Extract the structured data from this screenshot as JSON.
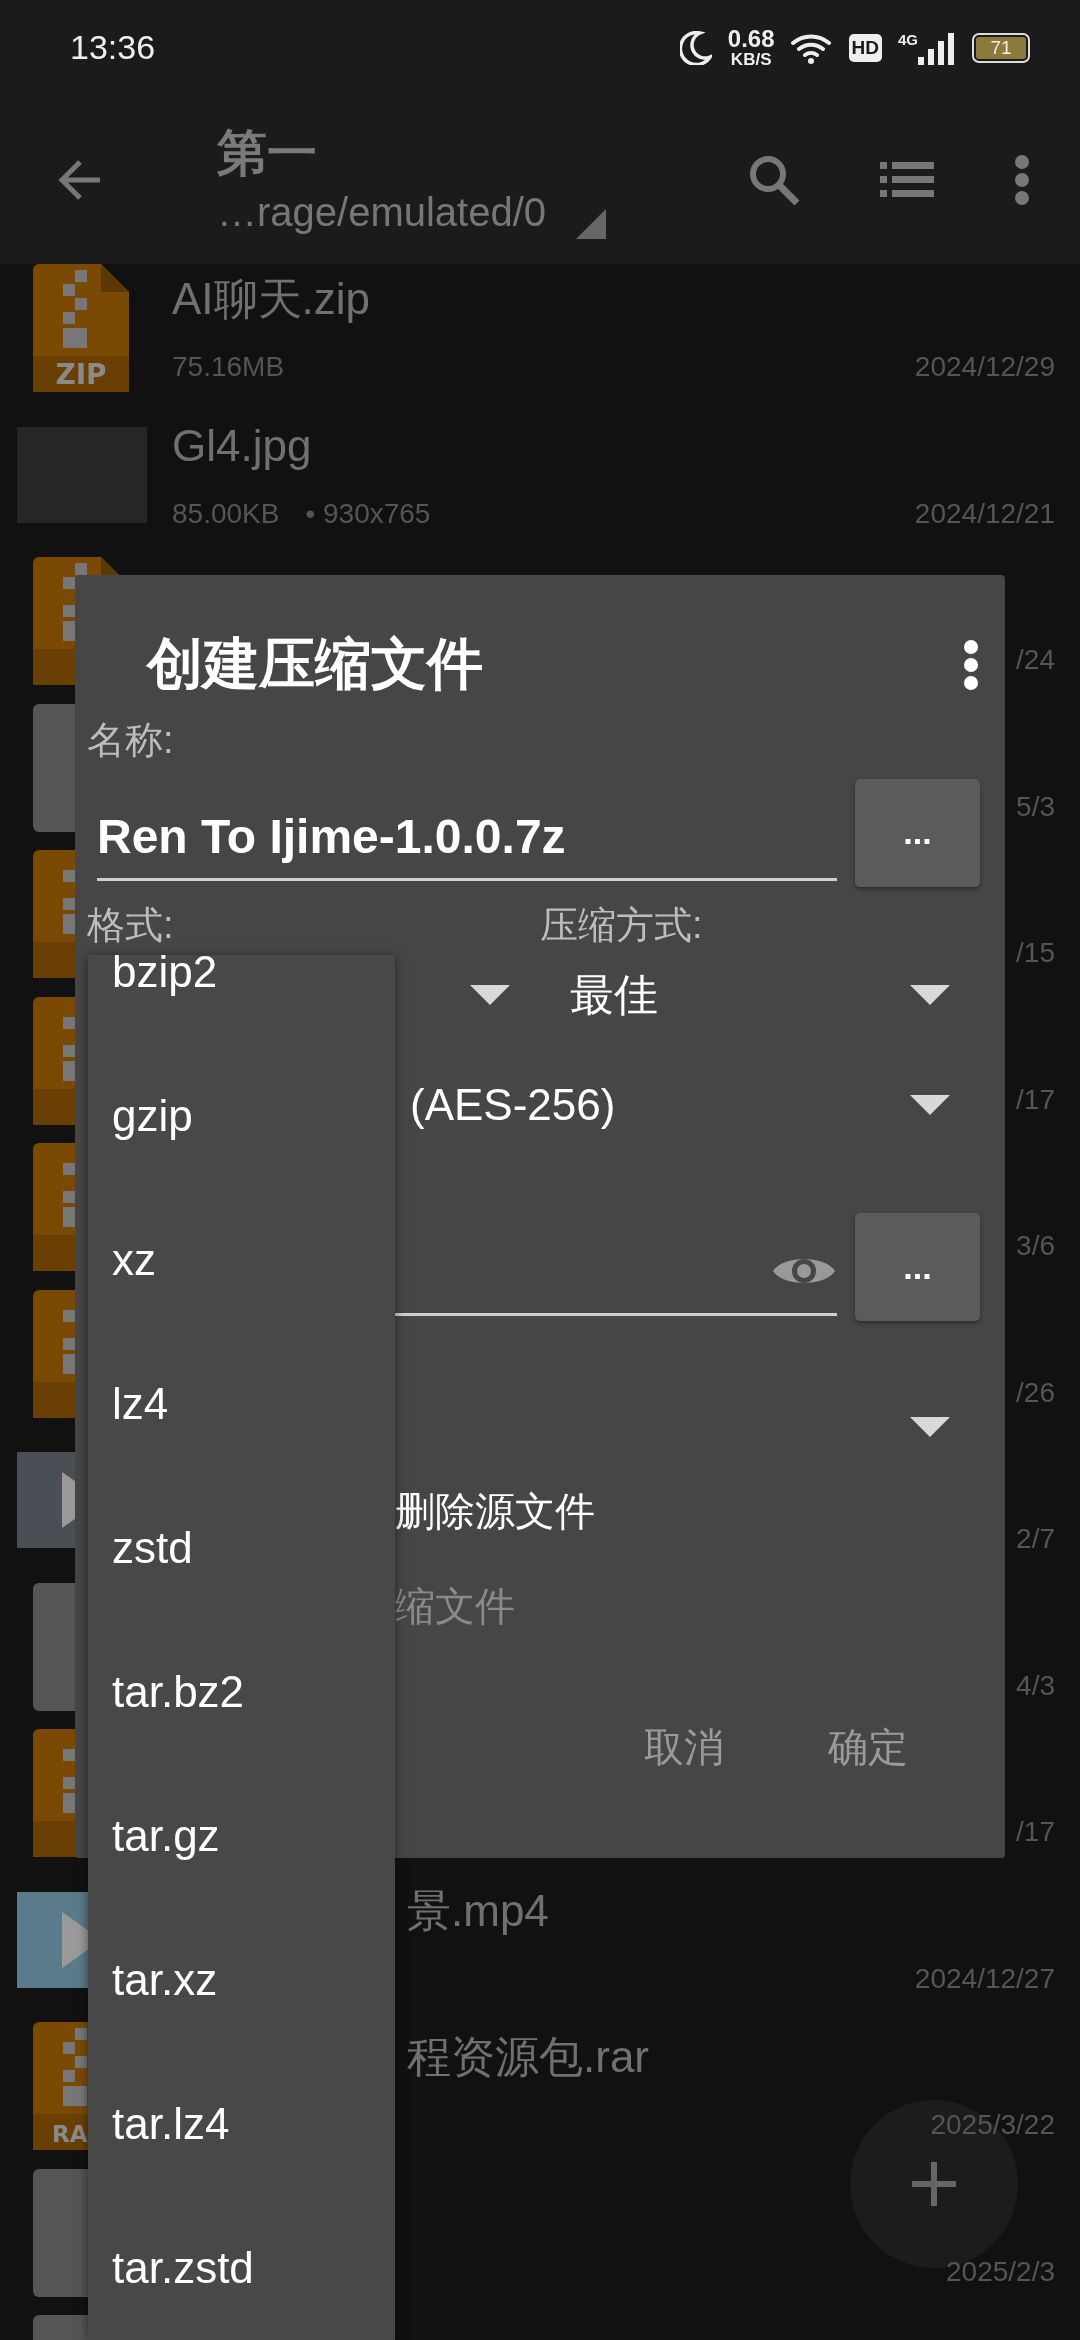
{
  "status_bar": {
    "time": "13:36",
    "net_speed": "0.68",
    "net_unit": "KB/S",
    "hd": "HD",
    "network": "4G",
    "battery": "71"
  },
  "toolbar": {
    "title": "第一",
    "path": "…rage/emulated/0"
  },
  "files": [
    {
      "kind": "zip",
      "badge": "ZIP",
      "name": "AI聊天.zip",
      "size": "75.16MB",
      "date": "2024/12/29"
    },
    {
      "kind": "image",
      "name": "Gl4.jpg",
      "size": "85.00KB",
      "dimensions": "• 930x765",
      "date": "2024/12/21"
    },
    {
      "kind": "archive",
      "date": "/24"
    },
    {
      "kind": "blank",
      "date": "5/3"
    },
    {
      "kind": "archive",
      "date": "/15"
    },
    {
      "kind": "archive",
      "date": "/17"
    },
    {
      "kind": "archive",
      "date": "3/6"
    },
    {
      "kind": "archive",
      "date": "/26"
    },
    {
      "kind": "video",
      "date": "2/7"
    },
    {
      "kind": "blank",
      "date": "4/3"
    },
    {
      "kind": "archive",
      "date": "/17"
    },
    {
      "kind": "video",
      "name": "景.mp4",
      "date": "2024/12/27"
    },
    {
      "kind": "archive",
      "badge": "RA",
      "name": "程资源包.rar",
      "date": "2025/3/22"
    },
    {
      "kind": "blank",
      "date": "2025/2/3"
    },
    {
      "kind": "blank"
    }
  ],
  "dialog": {
    "title": "创建压缩文件",
    "name_label": "名称:",
    "name_value": "Ren To Ijime-1.0.0.7z",
    "browse_button": "...",
    "format_label": "格式:",
    "method_label": "压缩方式:",
    "method_value": "最佳",
    "encryption_value": "(AES-256)",
    "password_browse": "...",
    "delete_source": {
      "label": "删除源文件"
    },
    "split_option": {
      "label": "缩文件",
      "disabled": true
    },
    "buttons": [
      {
        "label": "取消"
      },
      {
        "label": "确定"
      }
    ]
  },
  "format_menu": {
    "items": [
      {
        "label": "bzip2",
        "selected": false
      },
      {
        "label": "gzip",
        "selected": false
      },
      {
        "label": "xz",
        "selected": false
      },
      {
        "label": "lz4",
        "selected": false
      },
      {
        "label": "zstd",
        "selected": false
      },
      {
        "label": "tar.bz2",
        "selected": false
      },
      {
        "label": "tar.gz",
        "selected": false
      },
      {
        "label": "tar.xz",
        "selected": false
      },
      {
        "label": "tar.lz4",
        "selected": false
      },
      {
        "label": "tar.zstd",
        "selected": false
      }
    ]
  }
}
